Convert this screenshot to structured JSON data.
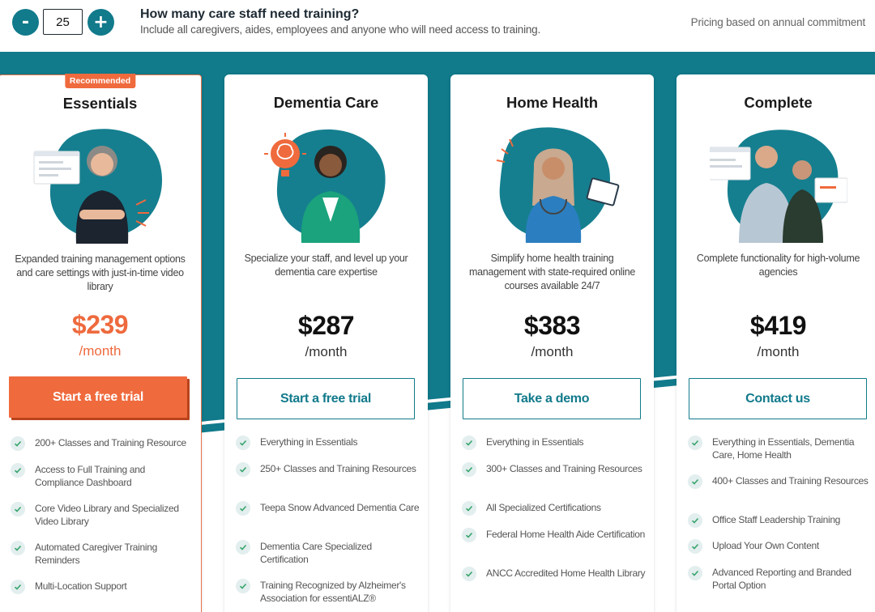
{
  "header": {
    "minus_label": "-",
    "plus_label": "+",
    "staff_count": "25",
    "question": "How many care staff need training?",
    "subtext": "Include all caregivers, aides, employees and anyone who will need access to training.",
    "pricing_note": "Pricing based on annual commitment"
  },
  "colors": {
    "teal": "#117a8b",
    "orange": "#ef6a3d"
  },
  "plans": [
    {
      "badge": "Recommended",
      "name": "Essentials",
      "description": "Expanded training management options and care settings with just-in-time video library",
      "price": "$239",
      "period": "/month",
      "cta": "Start a free trial",
      "features": [
        "200+ Classes and Training Resource",
        "Access to Full Training and Compliance Dashboard",
        "Core Video Library and Specialized Video Library",
        "Automated Caregiver Training Reminders",
        "Multi-Location Support"
      ]
    },
    {
      "name": "Dementia Care",
      "description": "Specialize your staff, and level up your dementia care expertise",
      "price": "$287",
      "period": "/month",
      "cta": "Start a free trial",
      "features": [
        "Everything in Essentials",
        "250+ Classes and Training Resources",
        "Teepa Snow Advanced Dementia Care",
        "Dementia Care Specialized Certification",
        "Training Recognized by Alzheimer's Association for essentiALZ®"
      ]
    },
    {
      "name": "Home Health",
      "description": "Simplify home health training management with state-required online courses available 24/7",
      "price": "$383",
      "period": "/month",
      "cta": "Take a demo",
      "features": [
        "Everything in Essentials",
        "300+ Classes and Training Resources",
        "All Specialized Certifications",
        "Federal Home Health Aide Certification",
        "ANCC Accredited Home Health Library"
      ]
    },
    {
      "name": "Complete",
      "description": "Complete functionality for high-volume agencies",
      "price": "$419",
      "period": "/month",
      "cta": "Contact us",
      "features": [
        "Everything in Essentials, Dementia Care, Home Health",
        "400+ Classes and Training Resources",
        "Office Staff Leadership Training",
        "Upload Your Own Content",
        "Advanced Reporting and Branded Portal Option"
      ]
    }
  ]
}
